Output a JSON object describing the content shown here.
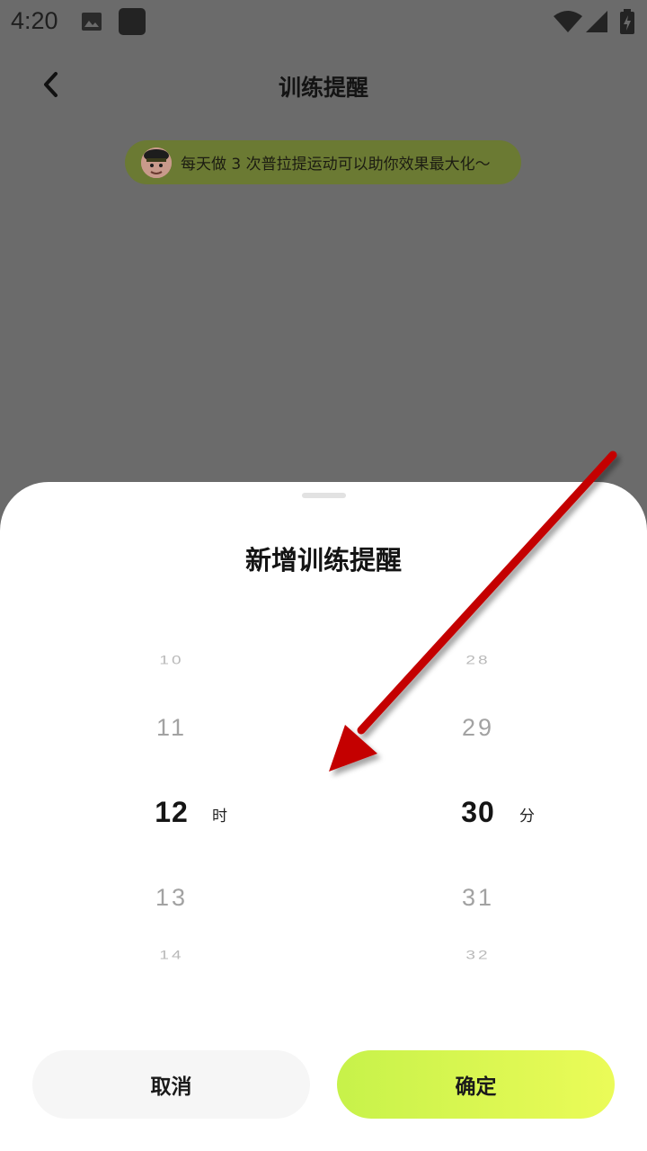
{
  "status_bar": {
    "time": "4:20",
    "icons": [
      "image-icon",
      "app-square-icon",
      "wifi-icon",
      "signal-icon",
      "battery-icon"
    ]
  },
  "header": {
    "title": "训练提醒",
    "back_icon": "chevron-left-icon"
  },
  "tip": {
    "text": "每天做 3 次普拉提运动可以助你效果最大化～",
    "avatar_icon": "character-avatar-icon"
  },
  "sheet": {
    "title": "新增训练提醒",
    "hours": {
      "far_above": "10",
      "near_above": "11",
      "selected": "12",
      "near_below": "13",
      "far_below": "14",
      "unit": "时"
    },
    "minutes": {
      "far_above": "28",
      "near_above": "29",
      "selected": "30",
      "near_below": "31",
      "far_below": "32",
      "unit": "分"
    },
    "cancel_label": "取消",
    "confirm_label": "确定"
  },
  "colors": {
    "overlay": "#6b6b6b",
    "tip_background": "#6b7a33",
    "confirm_gradient_start": "#c7f24a",
    "confirm_gradient_end": "#ebfb58",
    "annotation_arrow": "#cc0000"
  }
}
